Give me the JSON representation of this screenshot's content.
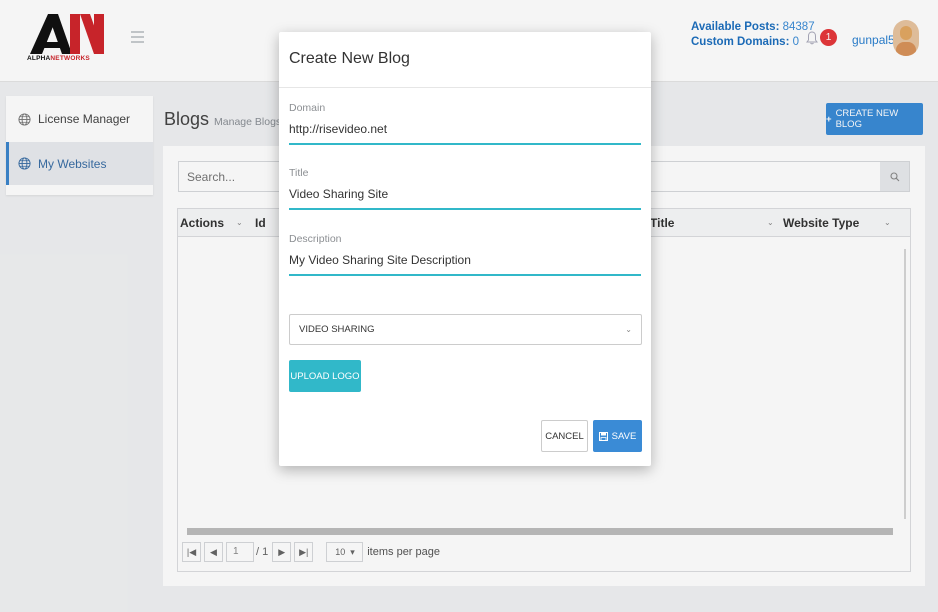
{
  "brand": {
    "logo_alpha": "ALPHA",
    "logo_networks": "NETWORKS",
    "logo_letters": "AN"
  },
  "header": {
    "available_posts_label": "Available Posts:",
    "available_posts_value": "84387",
    "custom_domains_label": "Custom Domains:",
    "custom_domains_value": "0",
    "notification_count": "1",
    "username": "gunpal5"
  },
  "sidebar": {
    "items": [
      {
        "label": "License Manager",
        "icon": "globe-icon",
        "active": false
      },
      {
        "label": "My Websites",
        "icon": "globe-icon",
        "active": true
      }
    ]
  },
  "page": {
    "title": "Blogs",
    "subtitle": "Manage Blogs",
    "create_button": "CREATE NEW BLOG",
    "search_placeholder": "Search..."
  },
  "grid": {
    "columns": [
      "Actions",
      "Id",
      "Title",
      "Website Type"
    ],
    "pager": {
      "current_page": "1",
      "of_pages": "/ 1",
      "page_size": "10",
      "items_per_page_label": "items per page"
    }
  },
  "modal": {
    "title": "Create New Blog",
    "domain_label": "Domain",
    "domain_value": "http://risevideo.net",
    "title_label": "Title",
    "title_value": "Video Sharing Site",
    "description_label": "Description",
    "description_value": "My Video Sharing Site Description",
    "website_type_selected": "VIDEO SHARING",
    "upload_logo_button": "UPLOAD LOGO",
    "cancel_button": "CANCEL",
    "save_button": "SAVE"
  },
  "colors": {
    "accent_blue": "#3a8bd6",
    "accent_teal": "#31b8c9",
    "badge_red": "#e5383b",
    "logo_red": "#d0262c"
  }
}
